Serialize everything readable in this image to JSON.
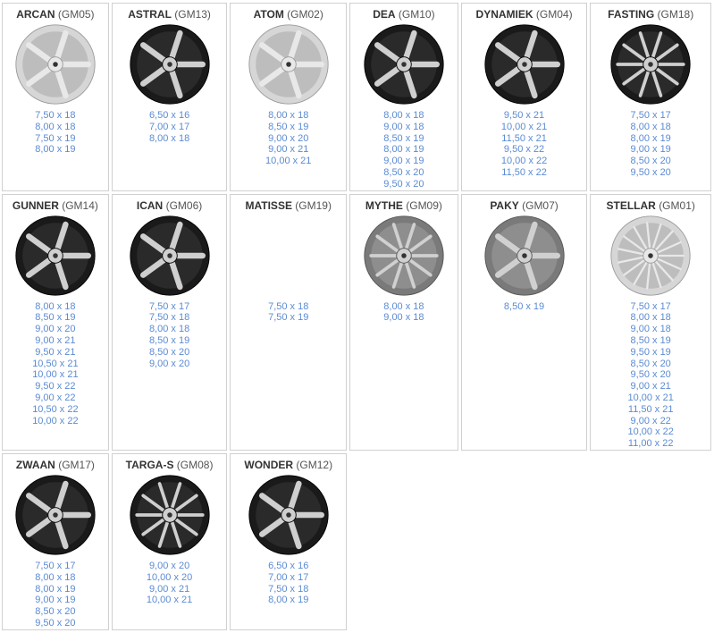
{
  "colors": {
    "link": "#5b8bd3",
    "silver": "#c8c8c8",
    "black": "#1e1e1e"
  },
  "rows": [
    [
      {
        "name": "ARCAN",
        "code": "(GM05)",
        "finish": "silver",
        "spokes": 5,
        "sizes": [
          "7,50 x 18",
          "8,00 x 18",
          "7,50 x 19",
          "8,00 x 19"
        ]
      },
      {
        "name": "ASTRAL",
        "code": "(GM13)",
        "finish": "black",
        "spokes": 5,
        "sizes": [
          "6,50 x 16",
          "7,00 x 17",
          "8,00 x 18"
        ]
      },
      {
        "name": "ATOM",
        "code": "(GM02)",
        "finish": "silver",
        "spokes": 5,
        "sizes": [
          "8,00 x 18",
          "8,50 x 19",
          "9,00 x 20",
          "9,00 x 21",
          "10,00 x 21"
        ]
      },
      {
        "name": "DEA",
        "code": "(GM10)",
        "finish": "black",
        "spokes": 5,
        "sizes": [
          "8,00 x 18",
          "9,00 x 18",
          "8,50 x 19",
          "8,00 x 19",
          "9,00 x 19",
          "8,50 x 20",
          "9,50 x 20"
        ]
      },
      {
        "name": "DYNAMIEK",
        "code": "(GM04)",
        "finish": "black",
        "spokes": 5,
        "sizes": [
          "9,50 x 21",
          "10,00 x 21",
          "11,50 x 21",
          "9,50 x 22",
          "10,00 x 22",
          "11,50 x 22"
        ]
      },
      {
        "name": "FASTING",
        "code": "(GM18)",
        "finish": "black",
        "spokes": 10,
        "sizes": [
          "7,50 x 17",
          "8,00 x 18",
          "8,00 x 19",
          "9,00 x 19",
          "8,50 x 20",
          "9,50 x 20"
        ]
      }
    ],
    [
      {
        "name": "GUNNER",
        "code": "(GM14)",
        "finish": "black",
        "spokes": 5,
        "sizes": [
          "8,00 x 18",
          "8,50 x 19",
          "9,00 x 20",
          "9,00 x 21",
          "9,50 x 21",
          "10,50 x 21",
          "10,00 x 21",
          "9,50 x 22",
          "9,00 x 22",
          "10,50 x 22",
          "10,00 x 22"
        ]
      },
      {
        "name": "ICAN",
        "code": "(GM06)",
        "finish": "black",
        "spokes": 5,
        "sizes": [
          "7,50 x 17",
          "7,50 x 18",
          "8,00 x 18",
          "8,50 x 19",
          "8,50 x 20",
          "9,00 x 20"
        ]
      },
      {
        "name": "MATISSE",
        "code": "(GM19)",
        "finish": "none",
        "spokes": 0,
        "sizes": [
          "7,50 x 18",
          "7,50 x 19"
        ]
      },
      {
        "name": "MYTHE",
        "code": "(GM09)",
        "finish": "gunmetal",
        "spokes": 10,
        "sizes": [
          "8,00 x 18",
          "9,00 x 18"
        ]
      },
      {
        "name": "PAKY",
        "code": "(GM07)",
        "finish": "gunmetal",
        "spokes": 5,
        "sizes": [
          "8,50 x 19"
        ]
      },
      {
        "name": "STELLAR",
        "code": "(GM01)",
        "finish": "silver",
        "spokes": 15,
        "sizes": [
          "7,50 x 17",
          "8,00 x 18",
          "9,00 x 18",
          "8,50 x 19",
          "9,50 x 19",
          "8,50 x 20",
          "9,50 x 20",
          "9,00 x 21",
          "10,00 x 21",
          "11,50 x 21",
          "9,00 x 22",
          "10,00 x 22",
          "11,00 x 22"
        ]
      }
    ],
    [
      {
        "name": "ZWAAN",
        "code": "(GM17)",
        "finish": "black",
        "spokes": 5,
        "sizes": [
          "7,50 x 17",
          "8,00 x 18",
          "8,00 x 19",
          "9,00 x 19",
          "8,50 x 20",
          "9,50 x 20"
        ]
      },
      {
        "name": "TARGA-S",
        "code": "(GM08)",
        "finish": "black",
        "spokes": 10,
        "sizes": [
          "9,00 x 20",
          "10,00 x 20",
          "9,00 x 21",
          "10,00 x 21"
        ]
      },
      {
        "name": "WONDER",
        "code": "(GM12)",
        "finish": "black",
        "spokes": 5,
        "sizes": [
          "6,50 x 16",
          "7,00 x 17",
          "7,50 x 18",
          "8,00 x 19"
        ]
      }
    ]
  ]
}
